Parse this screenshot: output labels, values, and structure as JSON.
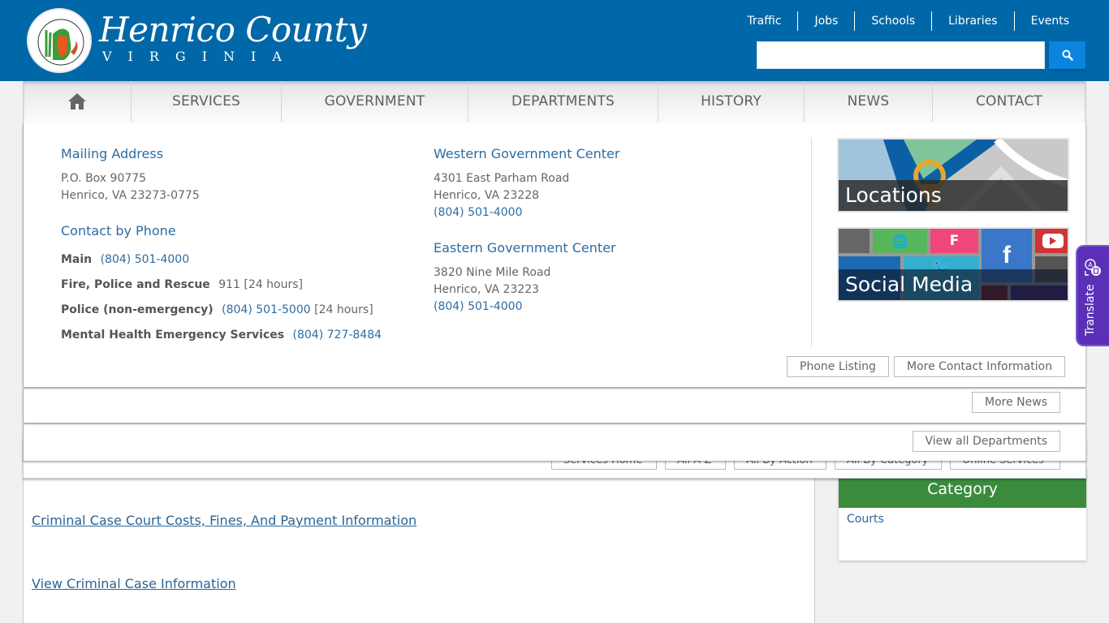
{
  "header": {
    "title": "Henrico County",
    "subtitle": "VIRGINIA",
    "seal_text": "County of Henrico, Virginia",
    "top_links": [
      "Traffic",
      "Jobs",
      "Schools",
      "Libraries",
      "Events"
    ],
    "search": {
      "value": "",
      "placeholder": ""
    },
    "search_icon": "search-icon",
    "colors": {
      "header_bg": "#0068a8",
      "search_btn": "#0a84df"
    }
  },
  "nav": {
    "home_icon": "home-icon",
    "items": [
      "SERVICES",
      "GOVERNMENT",
      "DEPARTMENTS",
      "HISTORY",
      "NEWS",
      "CONTACT"
    ]
  },
  "contact_panel": {
    "mailing": {
      "heading": "Mailing Address",
      "line1": "P.O. Box 90775",
      "line2": "Henrico, VA 23273-0775"
    },
    "phone": {
      "heading": "Contact by Phone",
      "entries": [
        {
          "label": "Main",
          "number": "(804) 501-4000",
          "note": ""
        },
        {
          "label": "Fire, Police and Rescue",
          "number": "911",
          "note": "[24 hours]"
        },
        {
          "label": "Police (non-emergency)",
          "number": "(804) 501-5000",
          "note": "[24 hours]"
        },
        {
          "label": "Mental Health Emergency Services",
          "number": "(804) 727-8484",
          "note": ""
        }
      ]
    },
    "western": {
      "heading": "Western Government Center",
      "line1": "4301 East Parham Road",
      "line2": "Henrico, VA 23228",
      "phone": "(804) 501-4000"
    },
    "eastern": {
      "heading": "Eastern Government Center",
      "line1": "3820 Nine Mile Road",
      "line2": "Henrico, VA 23223",
      "phone": "(804) 501-4000"
    },
    "tiles": [
      {
        "label": "Locations",
        "icon": "map-pin-icon"
      },
      {
        "label": "Social Media",
        "icons": [
          "globe-icon",
          "foursquare-icon",
          "facebook-icon",
          "youtube-icon",
          "twitter-icon"
        ]
      }
    ],
    "buttons": {
      "phone_listing": "Phone Listing",
      "more_contact": "More Contact Information"
    }
  },
  "news_panel": {
    "more_news": "More News"
  },
  "departments_panel": {
    "view_all": "View all Departments"
  },
  "services_panel": {
    "buttons": [
      "Services Home",
      "All A-Z",
      "All By Action",
      "All By Category",
      "Online Services"
    ]
  },
  "content": {
    "links": [
      "Criminal Case Court Costs, Fines, And Payment Information",
      "View Criminal Case Information"
    ]
  },
  "sidebar": {
    "category_heading": "Category",
    "category_links": [
      "Courts"
    ],
    "colors": {
      "category_bg": "#3a8c3c"
    }
  },
  "translate": {
    "label": "Translate",
    "icon": "translate-icon",
    "color": "#5b2fb6"
  }
}
